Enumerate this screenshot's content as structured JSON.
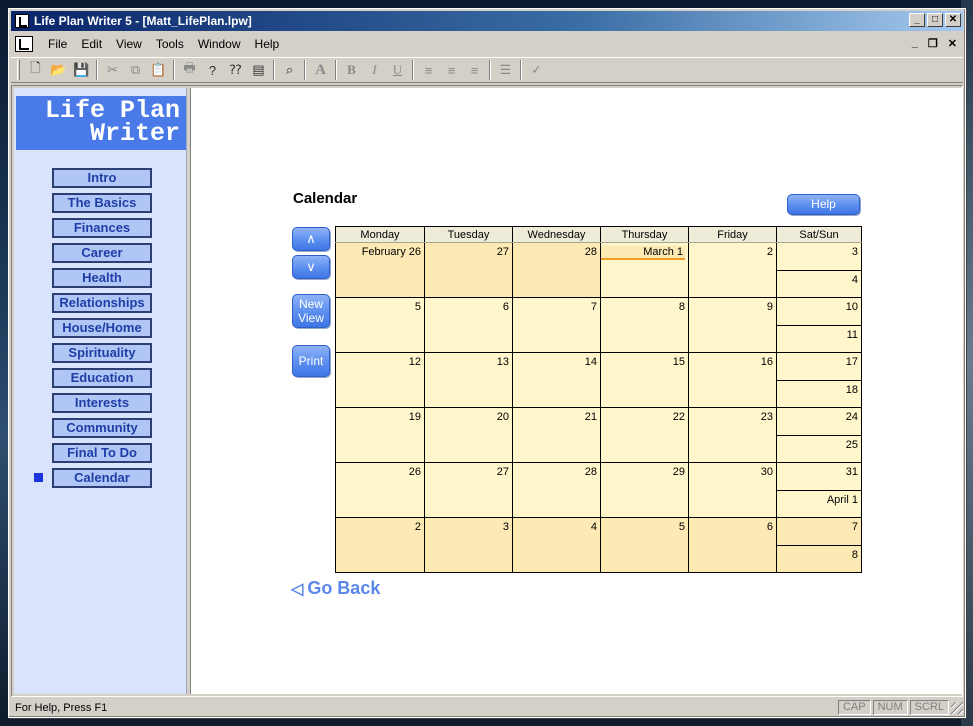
{
  "window": {
    "title": "Life Plan Writer 5 - [Matt_LifePlan.lpw]",
    "controls": {
      "minimize": "_",
      "maximize": "□",
      "close": "✕"
    }
  },
  "menu": {
    "items": [
      "File",
      "Edit",
      "View",
      "Tools",
      "Window",
      "Help"
    ],
    "mdi": {
      "minimize": "_",
      "restore": "❐",
      "close": "✕"
    }
  },
  "toolbar": {
    "icons": [
      "new-icon",
      "open-icon",
      "save-icon",
      "cut-icon",
      "copy-icon",
      "paste-icon",
      "print-icon",
      "help-icon",
      "context-help-icon",
      "notes-icon",
      "find-icon",
      "font-icon",
      "bold-icon",
      "italic-icon",
      "underline-icon",
      "align-left-icon",
      "align-center-icon",
      "align-right-icon",
      "bullets-icon",
      "spellcheck-icon"
    ],
    "glyphs": {
      "new": "🗋",
      "open": "📂",
      "save": "💾",
      "cut": "✂",
      "copy": "⧉",
      "paste": "📋",
      "print": "🖶",
      "help": "?",
      "context_help": "⁇",
      "notes": "▤",
      "find": "⌕",
      "font": "A",
      "bold": "B",
      "italic": "I",
      "underline": "U",
      "align_left": "≡",
      "align_center": "≡",
      "align_right": "≡",
      "bullets": "☰",
      "spell": "✓"
    }
  },
  "sidebar": {
    "logo_line1": "Life Plan",
    "logo_line2": "Writer",
    "items": [
      "Intro",
      "The Basics",
      "Finances",
      "Career",
      "Health",
      "Relationships",
      "House/Home",
      "Spirituality",
      "Education",
      "Interests",
      "Community",
      "Final To Do",
      "Calendar"
    ],
    "active_index": 12
  },
  "page": {
    "title": "Calendar",
    "help_label": "Help",
    "up_label": "∧",
    "down_label": "∨",
    "new_view_line1": "New",
    "new_view_line2": "View",
    "print_label": "Print",
    "go_back_arrow": "◁",
    "go_back_label": "Go Back"
  },
  "calendar": {
    "headers": [
      "Monday",
      "Tuesday",
      "Wednesday",
      "Thursday",
      "Friday",
      "Sat/Sun"
    ],
    "weeks": [
      {
        "days": [
          "February 26",
          "27",
          "28",
          "March 1",
          "2"
        ],
        "sat": "3",
        "sun": "4",
        "dim": [
          true,
          true,
          true,
          false,
          false,
          false
        ]
      },
      {
        "days": [
          "5",
          "6",
          "7",
          "8",
          "9"
        ],
        "sat": "10",
        "sun": "11",
        "dim": [
          false,
          false,
          false,
          false,
          false,
          false
        ]
      },
      {
        "days": [
          "12",
          "13",
          "14",
          "15",
          "16"
        ],
        "sat": "17",
        "sun": "18",
        "dim": [
          false,
          false,
          false,
          false,
          false,
          false
        ]
      },
      {
        "days": [
          "19",
          "20",
          "21",
          "22",
          "23"
        ],
        "sat": "24",
        "sun": "25",
        "dim": [
          false,
          false,
          false,
          false,
          false,
          false
        ]
      },
      {
        "days": [
          "26",
          "27",
          "28",
          "29",
          "30"
        ],
        "sat": "31",
        "sun": "April 1",
        "dim": [
          false,
          false,
          false,
          false,
          false,
          false
        ]
      },
      {
        "days": [
          "2",
          "3",
          "4",
          "5",
          "6"
        ],
        "sat": "7",
        "sun": "8",
        "dim": [
          true,
          true,
          true,
          true,
          true,
          true
        ]
      }
    ],
    "today": "March 1"
  },
  "status": {
    "text": "For Help, Press F1",
    "panes": [
      "CAP",
      "NUM",
      "SCRL"
    ]
  },
  "colors": {
    "accent": "#4a7ae8",
    "nav_text": "#1f3ea8",
    "cell_bg": "#fff6cc",
    "cell_dim_bg": "#fde9b4"
  }
}
